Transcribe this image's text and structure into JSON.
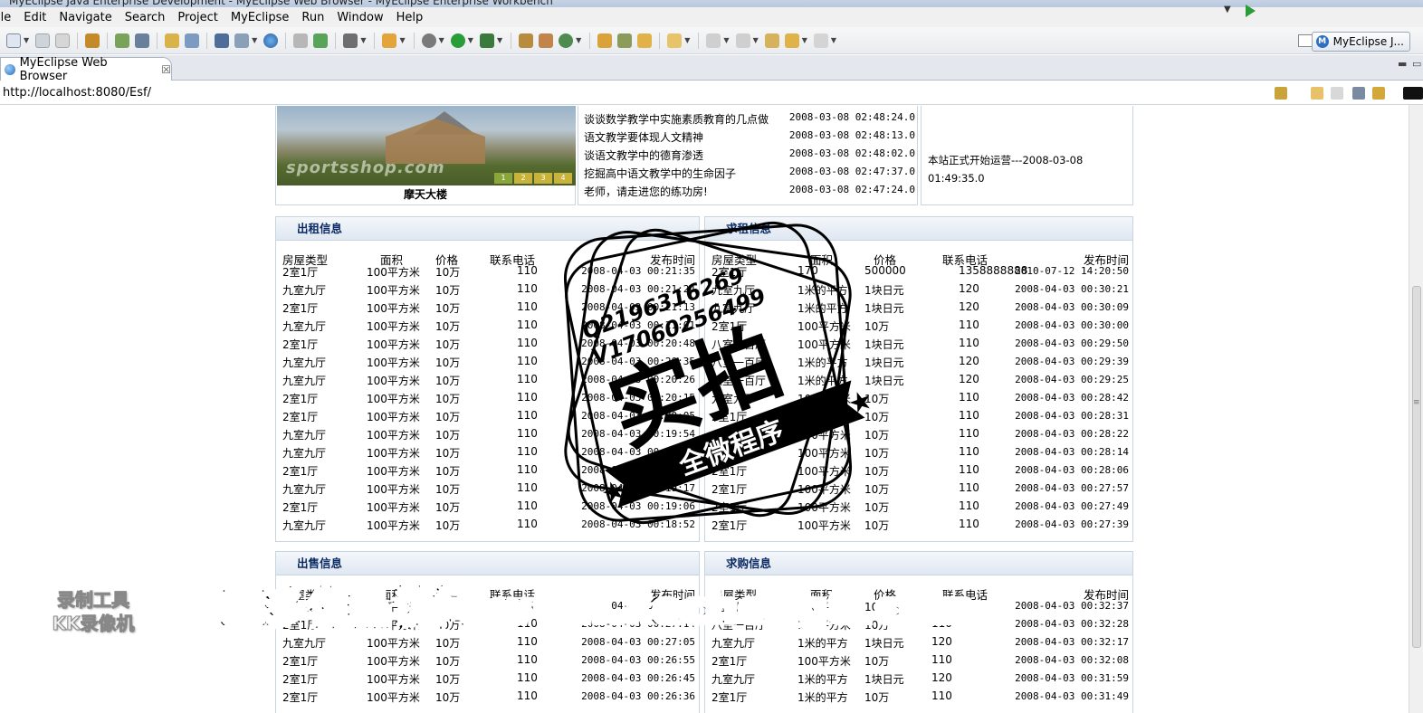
{
  "window": {
    "title": "MyEclipse Java Enterprise Development - MyEclipse Web Browser - MyEclipse Enterprise Workbench"
  },
  "menu": [
    "ile",
    "Edit",
    "Navigate",
    "Search",
    "Project",
    "MyEclipse",
    "Run",
    "Window",
    "Help"
  ],
  "perspective": {
    "label": "MyEclipse J..."
  },
  "tab": {
    "label": "MyEclipse Web Browser",
    "close": "☒"
  },
  "browser": {
    "url": "http://localhost:8080/Esf/"
  },
  "carousel": {
    "caption": "摩天大楼",
    "watermark": "sportsshop.com",
    "pages": [
      "1",
      "2",
      "3",
      "4"
    ]
  },
  "news": [
    {
      "title": "谈谈数学教学中实施素质教育的几点做",
      "time": "2008-03-08 02:48:24.0"
    },
    {
      "title": "语文教学要体现人文精神",
      "time": "2008-03-08 02:48:13.0"
    },
    {
      "title": "谈语文教学中的德育渗透",
      "time": "2008-03-08 02:48:02.0"
    },
    {
      "title": "挖掘高中语文教学中的生命因子",
      "time": "2008-03-08 02:47:37.0"
    },
    {
      "title": "老师，请走进您的练功房!",
      "time": "2008-03-08 02:47:24.0"
    }
  ],
  "notice": {
    "text": "本站正式开始运营---2008-03-08 01:49:35.0"
  },
  "rent_out": {
    "title": "出租信息",
    "headers": [
      "房屋类型",
      "面积",
      "价格",
      "联系电话",
      "发布时间"
    ],
    "rows": [
      [
        "2室1厅",
        "100平方米",
        "10万",
        "110",
        "2008-04-03 00:21:35"
      ],
      [
        "九室九厅",
        "100平方米",
        "10万",
        "110",
        "2008-04-03 00:21:24"
      ],
      [
        "2室1厅",
        "100平方米",
        "10万",
        "110",
        "2008-04-03 00:21:13"
      ],
      [
        "九室九厅",
        "100平方米",
        "10万",
        "110",
        "2008-04-03 00:21:01"
      ],
      [
        "2室1厅",
        "100平方米",
        "10万",
        "110",
        "2008-04-03 00:20:48"
      ],
      [
        "九室九厅",
        "100平方米",
        "10万",
        "110",
        "2008-04-03 00:20:35"
      ],
      [
        "九室九厅",
        "100平方米",
        "10万",
        "110",
        "2008-04-03 00:20:26"
      ],
      [
        "2室1厅",
        "100平方米",
        "10万",
        "110",
        "2008-04-03 00:20:15"
      ],
      [
        "2室1厅",
        "100平方米",
        "10万",
        "110",
        "2008-04-03 00:20:05"
      ],
      [
        "九室九厅",
        "100平方米",
        "10万",
        "110",
        "2008-04-03 00:19:54"
      ],
      [
        "九室九厅",
        "100平方米",
        "10万",
        "110",
        "2008-04-03 00:19:41"
      ],
      [
        "2室1厅",
        "100平方米",
        "10万",
        "110",
        "2008-04-03 00:19:29"
      ],
      [
        "九室九厅",
        "100平方米",
        "10万",
        "110",
        "2008-04-03 00:19:17"
      ],
      [
        "2室1厅",
        "100平方米",
        "10万",
        "110",
        "2008-04-03 00:19:06"
      ],
      [
        "九室九厅",
        "100平方米",
        "10万",
        "110",
        "2008-04-03 00:18:52"
      ]
    ]
  },
  "rent_wanted": {
    "title": "求租信息",
    "headers": [
      "房屋类型",
      "面积",
      "价格",
      "联系电话",
      "发布时间"
    ],
    "rows": [
      [
        "2室1厅",
        "170",
        "500000",
        "1358888888",
        "2010-07-12 14:20:50"
      ],
      [
        "九室九厅",
        "1米的平方",
        "1块日元",
        "120",
        "2008-04-03 00:30:21"
      ],
      [
        "九室九厅",
        "1米的平方",
        "1块日元",
        "120",
        "2008-04-03 00:30:09"
      ],
      [
        "2室1厅",
        "100平方米",
        "10万",
        "110",
        "2008-04-03 00:30:00"
      ],
      [
        "八室一百厅",
        "100平方米",
        "1块日元",
        "110",
        "2008-04-03 00:29:50"
      ],
      [
        "八室一百厅",
        "1米的平方",
        "1块日元",
        "120",
        "2008-04-03 00:29:39"
      ],
      [
        "八室一百厅",
        "1米的平方",
        "1块日元",
        "120",
        "2008-04-03 00:29:25"
      ],
      [
        "九室九厅",
        "100平方米",
        "10万",
        "110",
        "2008-04-03 00:28:42"
      ],
      [
        "2室1厅",
        "100平方米",
        "10万",
        "110",
        "2008-04-03 00:28:31"
      ],
      [
        "2室1厅",
        "100平方米",
        "10万",
        "110",
        "2008-04-03 00:28:22"
      ],
      [
        "2室1厅",
        "100平方米",
        "10万",
        "110",
        "2008-04-03 00:28:14"
      ],
      [
        "2室1厅",
        "100平方米",
        "10万",
        "110",
        "2008-04-03 00:28:06"
      ],
      [
        "2室1厅",
        "100平方米",
        "10万",
        "110",
        "2008-04-03 00:27:57"
      ],
      [
        "2室1厅",
        "100平方米",
        "10万",
        "110",
        "2008-04-03 00:27:49"
      ],
      [
        "2室1厅",
        "100平方米",
        "10万",
        "110",
        "2008-04-03 00:27:39"
      ]
    ]
  },
  "for_sale": {
    "title": "出售信息",
    "headers": [
      "房屋类型",
      "面积",
      "价格",
      "联系电话",
      "发布时间"
    ],
    "rows": [
      [
        "2室1厅",
        "100平方米",
        "10万",
        "110",
        "2008-04-03 00:27:24"
      ],
      [
        "2室1厅",
        "100平方米",
        "10万",
        "110",
        "2008-04-03 00:27:14"
      ],
      [
        "九室九厅",
        "100平方米",
        "10万",
        "110",
        "2008-04-03 00:27:05"
      ],
      [
        "2室1厅",
        "100平方米",
        "10万",
        "110",
        "2008-04-03 00:26:55"
      ],
      [
        "2室1厅",
        "100平方米",
        "10万",
        "110",
        "2008-04-03 00:26:45"
      ],
      [
        "2室1厅",
        "100平方米",
        "10万",
        "110",
        "2008-04-03 00:26:36"
      ]
    ]
  },
  "buy_wanted": {
    "title": "求购信息",
    "headers": [
      "房屋类型",
      "面积",
      "价格",
      "联系电话",
      "发布时间"
    ],
    "rows": [
      [
        "2室1厅",
        "100平方米",
        "10万",
        "110",
        "2008-04-03 00:32:37"
      ],
      [
        "八室一百厅",
        "100平方米",
        "10万",
        "110",
        "2008-04-03 00:32:28"
      ],
      [
        "九室九厅",
        "1米的平方",
        "1块日元",
        "120",
        "2008-04-03 00:32:17"
      ],
      [
        "2室1厅",
        "100平方米",
        "10万",
        "110",
        "2008-04-03 00:32:08"
      ],
      [
        "九室九厅",
        "1米的平方",
        "1块日元",
        "120",
        "2008-04-03 00:31:59"
      ],
      [
        "2室1厅",
        "1米的平方",
        "10万",
        "110",
        "2008-04-03 00:31:49"
      ]
    ]
  },
  "stamp": {
    "qq": "Q2196316269",
    "vx": "V17060256499",
    "big": "实拍",
    "ribbon": "全微程序"
  },
  "banner": {
    "text": "更多作品访问 www.kecheng8.com"
  },
  "recorder": {
    "line1": "录制工具",
    "line2": "KK录像机"
  },
  "colors": {
    "panel_header_text": "#0b2a63",
    "panel_border": "#c8d4e0"
  }
}
